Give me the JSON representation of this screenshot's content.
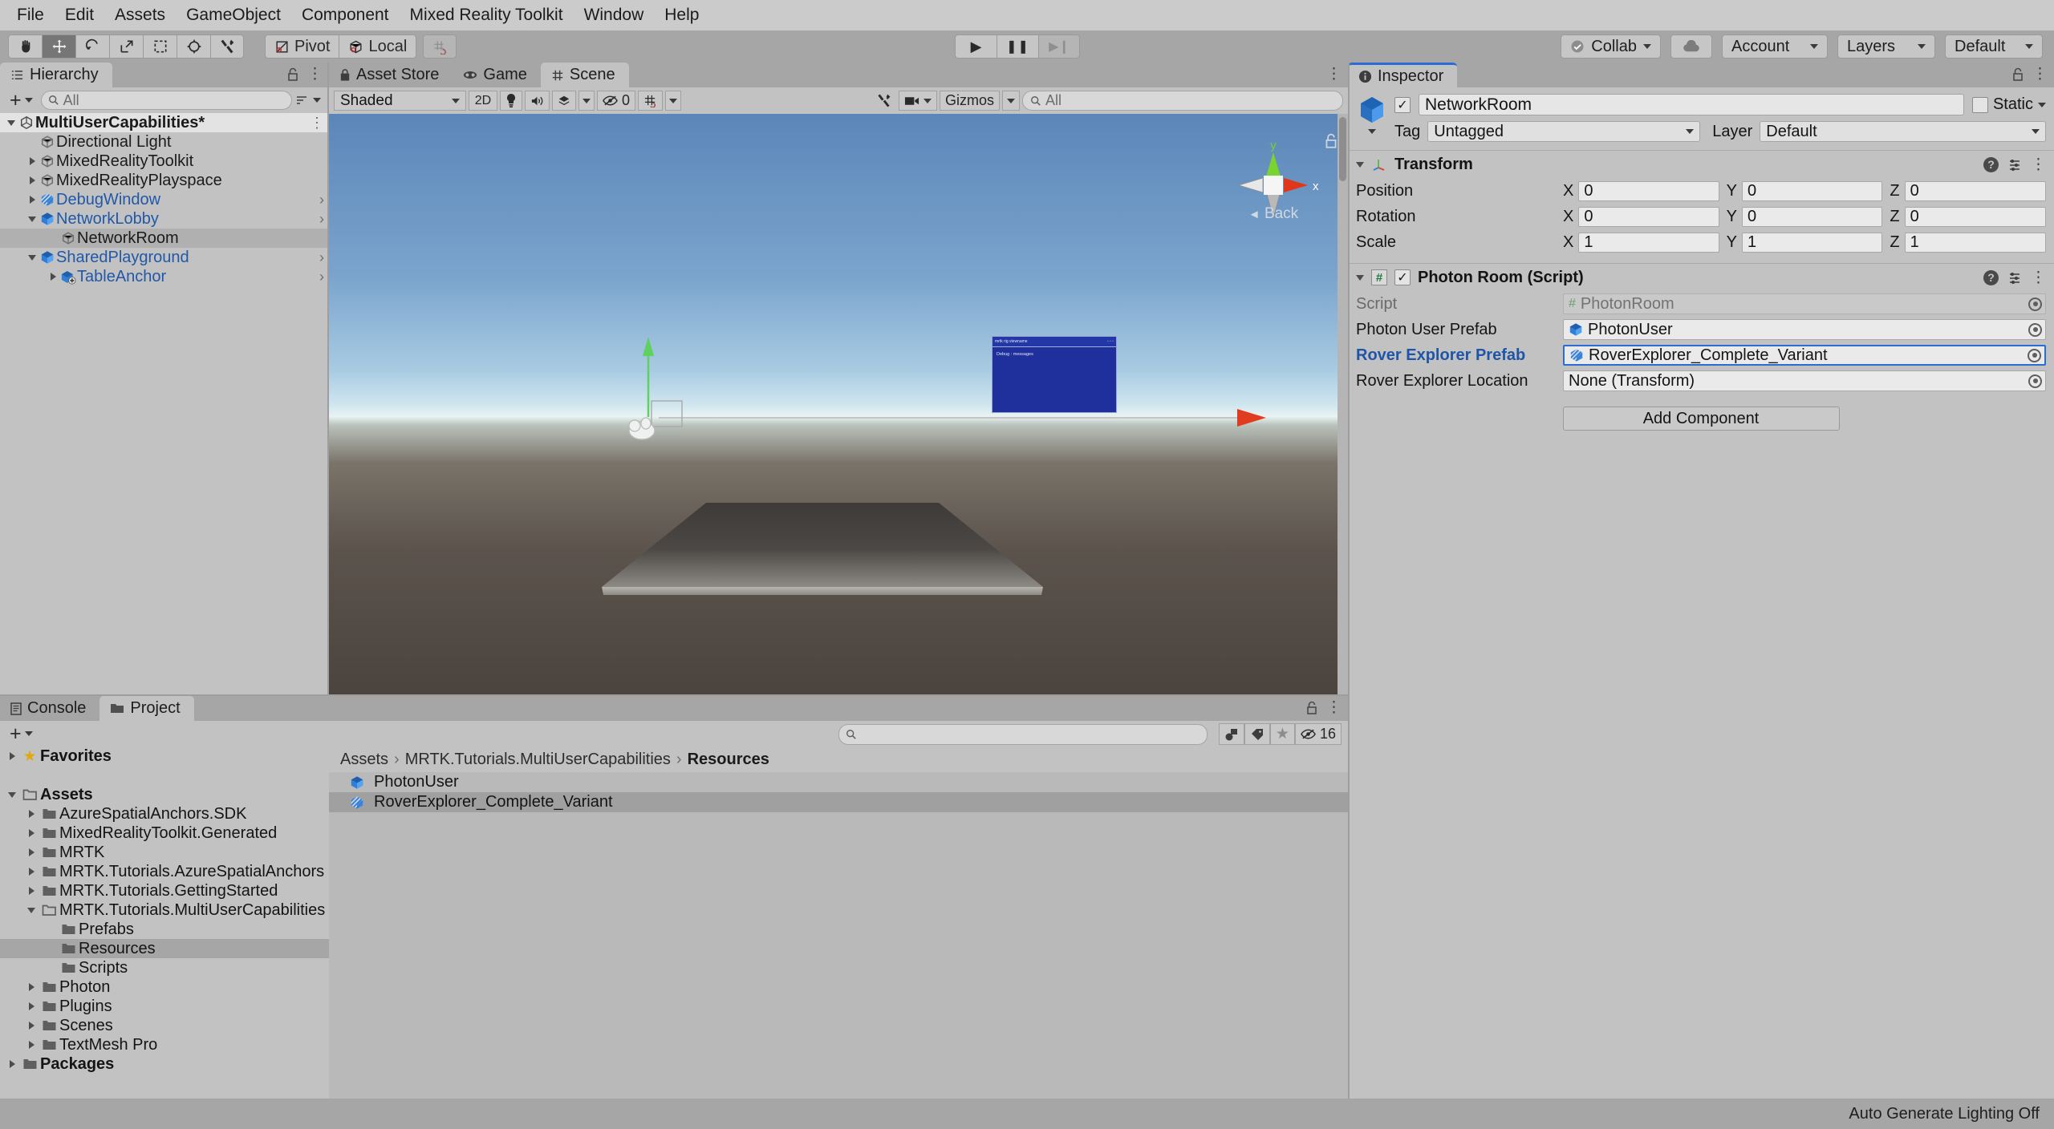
{
  "menubar": {
    "items": [
      "File",
      "Edit",
      "Assets",
      "GameObject",
      "Component",
      "Mixed Reality Toolkit",
      "Window",
      "Help"
    ]
  },
  "toolbar": {
    "tools": [
      {
        "name": "hand-tool",
        "glyph": "✋"
      },
      {
        "name": "move-tool",
        "glyph": "✥"
      },
      {
        "name": "rotate-tool",
        "glyph": "↺"
      },
      {
        "name": "scale-tool",
        "glyph": "⇱"
      },
      {
        "name": "rect-tool",
        "glyph": "⬚"
      },
      {
        "name": "transform-tool",
        "glyph": "✪"
      },
      {
        "name": "custom-tool",
        "glyph": "⚒"
      }
    ],
    "pivot_label": "Pivot",
    "local_label": "Local",
    "grid_label": "▦",
    "play_label": "▶",
    "pause_label": "❚❚",
    "step_label": "▶❙",
    "collab_label": "Collab",
    "cloud_label": "☁",
    "account_label": "Account",
    "layers_label": "Layers",
    "layout_label": "Default"
  },
  "hierarchy": {
    "tab_label": "Hierarchy",
    "search_placeholder": "All",
    "items": [
      {
        "label": "MultiUserCapabilities*",
        "depth": 0,
        "twisty": "down",
        "icon": "unity-scene-icon",
        "style": "scene",
        "chevron": false,
        "kebab": true
      },
      {
        "label": "Directional Light",
        "depth": 1,
        "twisty": "none",
        "icon": "gameobject-cube-icon",
        "style": "normal",
        "chevron": false
      },
      {
        "label": "MixedRealityToolkit",
        "depth": 1,
        "twisty": "right",
        "icon": "gameobject-cube-icon",
        "style": "normal",
        "chevron": false
      },
      {
        "label": "MixedRealityPlayspace",
        "depth": 1,
        "twisty": "right",
        "icon": "gameobject-cube-icon",
        "style": "normal",
        "chevron": false
      },
      {
        "label": "DebugWindow",
        "depth": 1,
        "twisty": "right",
        "icon": "prefab-variant-icon",
        "style": "prefab",
        "chevron": true
      },
      {
        "label": "NetworkLobby",
        "depth": 1,
        "twisty": "down",
        "icon": "prefab-cube-icon",
        "style": "prefab",
        "chevron": true
      },
      {
        "label": "NetworkRoom",
        "depth": 2,
        "twisty": "none",
        "icon": "gameobject-cube-icon",
        "style": "selected",
        "chevron": false
      },
      {
        "label": "SharedPlayground",
        "depth": 1,
        "twisty": "down",
        "icon": "prefab-cube-icon",
        "style": "prefab",
        "chevron": true
      },
      {
        "label": "TableAnchor",
        "depth": 2,
        "twisty": "right",
        "icon": "prefab-add-icon",
        "style": "prefab",
        "chevron": true
      }
    ]
  },
  "scene": {
    "tabs": [
      {
        "label": "Scene",
        "icon": "grid-icon",
        "active": true
      },
      {
        "label": "Game",
        "icon": "gamepad-icon",
        "active": false
      },
      {
        "label": "Asset Store",
        "icon": "store-icon",
        "active": false
      }
    ],
    "draw_mode": "Shaded",
    "twod_label": "2D",
    "light_icon": "lightbulb-icon",
    "audio_icon": "speaker-icon",
    "fx_icon": "effects-icon",
    "hidden_count": "0",
    "grid_icon": "grid-snap-icon",
    "tools_icon": "scene-tools-icon",
    "camera_icon": "camera-icon",
    "gizmos_label": "Gizmos",
    "search_placeholder": "All",
    "gizmo_axes": {
      "x": "x",
      "y": "y"
    },
    "gizmo_view_label": "Back",
    "back_arrow": "◄"
  },
  "inspector": {
    "tab_label": "Inspector",
    "lock_icon": "lock-icon",
    "object_name": "NetworkRoom",
    "enabled": true,
    "static_label": "Static",
    "tag_label": "Tag",
    "tag_value": "Untagged",
    "layer_label": "Layer",
    "layer_value": "Default",
    "transform": {
      "title": "Transform",
      "rows": [
        {
          "label": "Position",
          "x": "0",
          "y": "0",
          "z": "0"
        },
        {
          "label": "Rotation",
          "x": "0",
          "y": "0",
          "z": "0"
        },
        {
          "label": "Scale",
          "x": "1",
          "y": "1",
          "z": "1"
        }
      ],
      "axis_labels": [
        "X",
        "Y",
        "Z"
      ]
    },
    "photon_room": {
      "title": "Photon Room (Script)",
      "enabled": true,
      "script_label": "Script",
      "script_value": "PhotonRoom",
      "fields": [
        {
          "label": "Photon User Prefab",
          "value": "PhotonUser",
          "icon": "prefab-cube-icon",
          "highlight": false
        },
        {
          "label": "Rover Explorer Prefab",
          "value": "RoverExplorer_Complete_Variant",
          "icon": "prefab-variant-icon",
          "highlight": true
        },
        {
          "label": "Rover Explorer Location",
          "value": "None (Transform)",
          "icon": "none",
          "highlight": false
        }
      ]
    },
    "add_component_label": "Add Component"
  },
  "project": {
    "tabs": [
      {
        "label": "Project",
        "icon": "folder-icon",
        "active": true
      },
      {
        "label": "Console",
        "icon": "console-icon",
        "active": false
      }
    ],
    "search_placeholder": "",
    "visible_count": "16",
    "tree": [
      {
        "label": "Favorites",
        "depth": 0,
        "twisty": "right",
        "icon": "star-icon",
        "bold": true,
        "selected": false
      },
      {
        "label": "",
        "depth": 0,
        "twisty": "none",
        "icon": "none",
        "bold": false,
        "selected": false,
        "spacer": true
      },
      {
        "label": "Assets",
        "depth": 0,
        "twisty": "down",
        "icon": "folder-open-icon",
        "bold": true,
        "selected": false
      },
      {
        "label": "AzureSpatialAnchors.SDK",
        "depth": 1,
        "twisty": "right",
        "icon": "folder-icon",
        "bold": false,
        "selected": false
      },
      {
        "label": "MixedRealityToolkit.Generated",
        "depth": 1,
        "twisty": "right",
        "icon": "folder-icon",
        "bold": false,
        "selected": false
      },
      {
        "label": "MRTK",
        "depth": 1,
        "twisty": "right",
        "icon": "folder-icon",
        "bold": false,
        "selected": false
      },
      {
        "label": "MRTK.Tutorials.AzureSpatialAnchors",
        "depth": 1,
        "twisty": "right",
        "icon": "folder-icon",
        "bold": false,
        "selected": false
      },
      {
        "label": "MRTK.Tutorials.GettingStarted",
        "depth": 1,
        "twisty": "right",
        "icon": "folder-icon",
        "bold": false,
        "selected": false
      },
      {
        "label": "MRTK.Tutorials.MultiUserCapabilities",
        "depth": 1,
        "twisty": "down",
        "icon": "folder-open-icon",
        "bold": false,
        "selected": false
      },
      {
        "label": "Prefabs",
        "depth": 2,
        "twisty": "none",
        "icon": "folder-icon",
        "bold": false,
        "selected": false
      },
      {
        "label": "Resources",
        "depth": 2,
        "twisty": "none",
        "icon": "folder-icon",
        "bold": false,
        "selected": true
      },
      {
        "label": "Scripts",
        "depth": 2,
        "twisty": "none",
        "icon": "folder-icon",
        "bold": false,
        "selected": false
      },
      {
        "label": "Photon",
        "depth": 1,
        "twisty": "right",
        "icon": "folder-icon",
        "bold": false,
        "selected": false
      },
      {
        "label": "Plugins",
        "depth": 1,
        "twisty": "right",
        "icon": "folder-icon",
        "bold": false,
        "selected": false
      },
      {
        "label": "Scenes",
        "depth": 1,
        "twisty": "right",
        "icon": "folder-icon",
        "bold": false,
        "selected": false
      },
      {
        "label": "TextMesh Pro",
        "depth": 1,
        "twisty": "right",
        "icon": "folder-icon",
        "bold": false,
        "selected": false
      },
      {
        "label": "Packages",
        "depth": 0,
        "twisty": "right",
        "icon": "folder-icon",
        "bold": true,
        "selected": false
      }
    ],
    "breadcrumb": [
      "Assets",
      "MRTK.Tutorials.MultiUserCapabilities",
      "Resources"
    ],
    "assets": [
      {
        "label": "PhotonUser",
        "icon": "prefab-cube-icon",
        "selected": false
      },
      {
        "label": "RoverExplorer_Complete_Variant",
        "icon": "prefab-variant-icon",
        "selected": true
      }
    ]
  },
  "statusbar": {
    "message": "Auto Generate Lighting Off"
  },
  "colors": {
    "accent_blue": "#2b6cd4",
    "prefab_blue": "#2158a8",
    "panel_bg": "#c2c2c2",
    "toolbar_bg": "#a6a6a6",
    "selection": "#a0a0a0"
  }
}
